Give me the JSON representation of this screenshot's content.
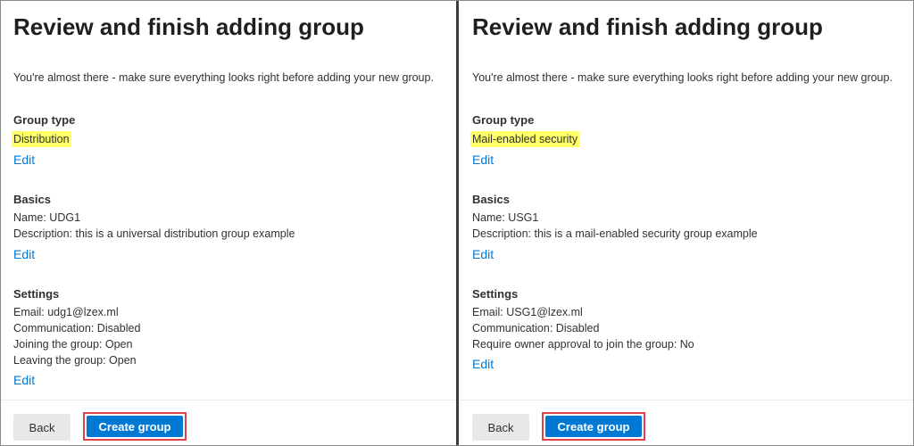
{
  "left": {
    "title": "Review and finish adding group",
    "intro": "You're almost there - make sure everything looks right before adding your new group.",
    "group_type": {
      "heading": "Group type",
      "value": "Distribution",
      "edit_label": "Edit"
    },
    "basics": {
      "heading": "Basics",
      "name": "Name: UDG1",
      "description": "Description: this is a universal distribution group example",
      "edit_label": "Edit"
    },
    "settings": {
      "heading": "Settings",
      "lines": [
        "Email: udg1@lzex.ml",
        "Communication: Disabled",
        "Joining the group: Open",
        "Leaving the group: Open"
      ],
      "edit_label": "Edit"
    },
    "footer": {
      "back_label": "Back",
      "create_label": "Create group"
    }
  },
  "right": {
    "title": "Review and finish adding group",
    "intro": "You're almost there - make sure everything looks right before adding your new group.",
    "group_type": {
      "heading": "Group type",
      "value": "Mail-enabled security",
      "edit_label": "Edit"
    },
    "basics": {
      "heading": "Basics",
      "name": "Name: USG1",
      "description": "Description: this is a mail-enabled security group example",
      "edit_label": "Edit"
    },
    "settings": {
      "heading": "Settings",
      "lines": [
        "Email: USG1@lzex.ml",
        "Communication: Disabled",
        "Require owner approval to join the group: No"
      ],
      "edit_label": "Edit"
    },
    "footer": {
      "back_label": "Back",
      "create_label": "Create group"
    }
  },
  "colors": {
    "accent": "#0078d4",
    "highlight": "#ffff66",
    "callout_border": "#e0414a"
  }
}
